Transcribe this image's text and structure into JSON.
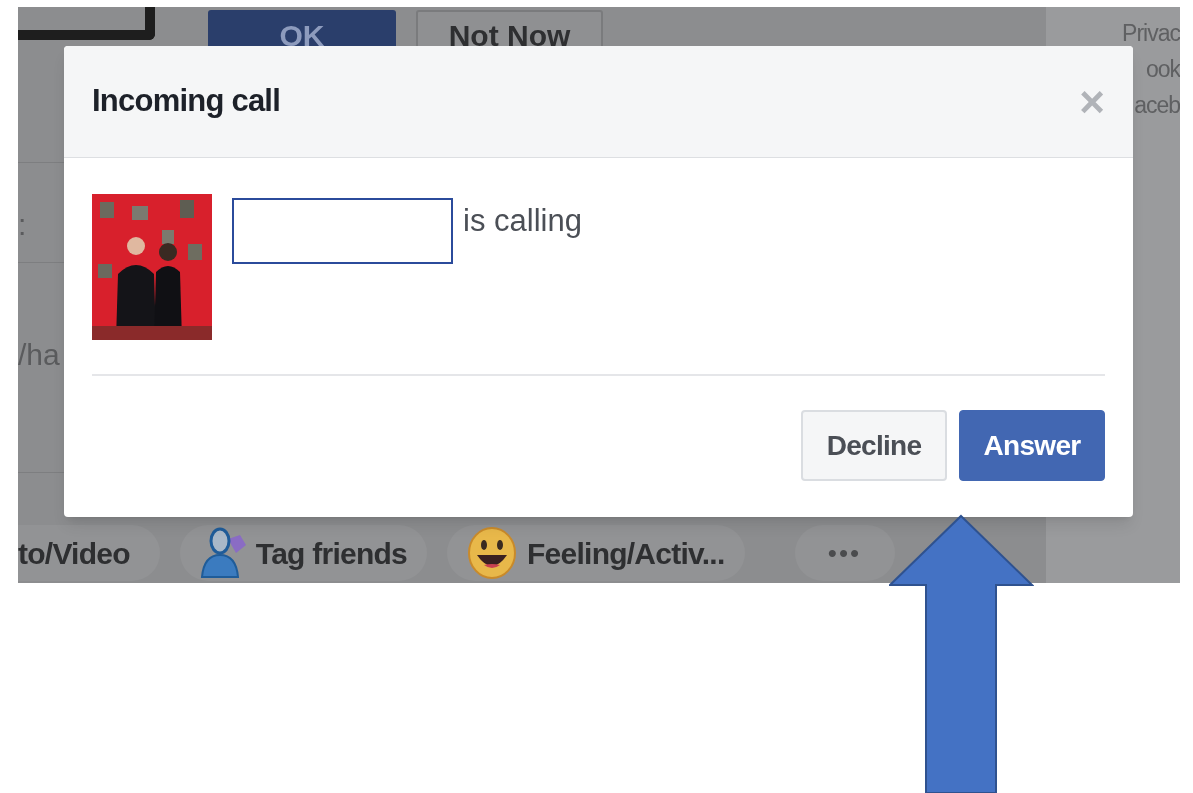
{
  "background": {
    "buttons": [
      {
        "label": "OK",
        "kind": "primary"
      },
      {
        "label": "Not Now",
        "kind": "secondary"
      }
    ],
    "sidebar_text": [
      "Privac",
      "ook",
      "aceb"
    ],
    "left_text": [
      ":",
      "/ha"
    ],
    "composer_actions": [
      {
        "label": "to/Video",
        "kind": "text"
      },
      {
        "label": "Tag friends",
        "kind": "tag"
      },
      {
        "label": "Feeling/Activ...",
        "kind": "feeling"
      },
      {
        "label": "•••",
        "kind": "more"
      }
    ]
  },
  "dialog": {
    "title": "Incoming call",
    "close": "×",
    "message": "is calling",
    "buttons": [
      {
        "label": "Decline",
        "kind": "secondary"
      },
      {
        "label": "Answer",
        "kind": "primary"
      }
    ]
  }
}
